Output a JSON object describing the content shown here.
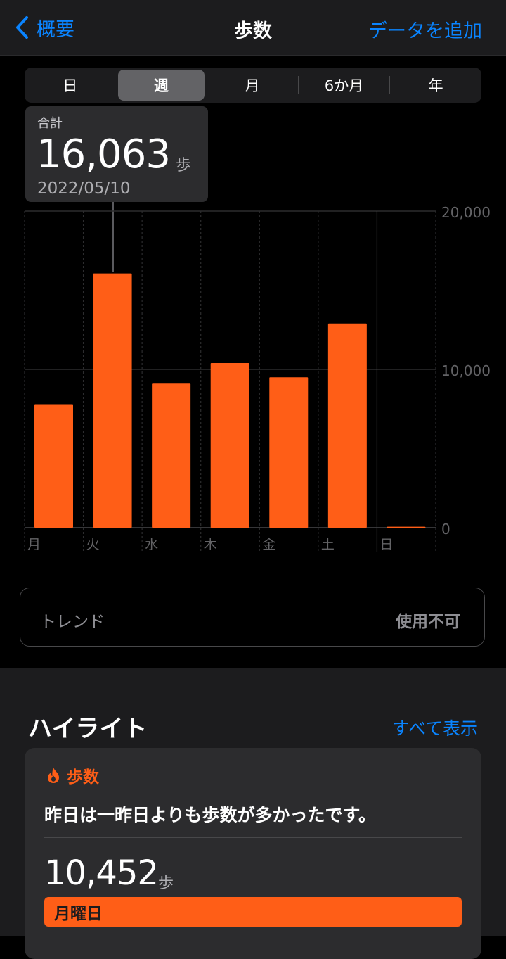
{
  "navbar": {
    "back_label": "概要",
    "title": "歩数",
    "add_label": "データを追加"
  },
  "segments": [
    {
      "label": "日",
      "active": false
    },
    {
      "label": "週",
      "active": true
    },
    {
      "label": "月",
      "active": false
    },
    {
      "label": "6か月",
      "active": false
    },
    {
      "label": "年",
      "active": false
    }
  ],
  "callout": {
    "label": "合計",
    "value": "16,063",
    "unit": "歩",
    "date": "2022/05/10"
  },
  "chart_data": {
    "type": "bar",
    "categories": [
      "月",
      "火",
      "水",
      "木",
      "金",
      "土",
      "日"
    ],
    "values": [
      7800,
      16063,
      9100,
      10400,
      9500,
      12900,
      60
    ],
    "ylim": [
      0,
      20000
    ],
    "ytick_labels": [
      "0",
      "10,000",
      "20,000"
    ],
    "ytick_values": [
      0,
      10000,
      20000
    ],
    "selected_index": 1,
    "bar_color": "#ff5e17"
  },
  "trend": {
    "label": "トレンド",
    "value": "使用不可"
  },
  "highlights": {
    "title": "ハイライト",
    "show_all": "すべて表示",
    "card": {
      "category": "歩数",
      "text": "昨日は一昨日よりも歩数が多かったです。",
      "value": "10,452",
      "unit": "歩",
      "bar_label": "月曜日"
    }
  },
  "colors": {
    "accent": "#0a84ff",
    "steps": "#ff5e17",
    "background": "#000000"
  }
}
